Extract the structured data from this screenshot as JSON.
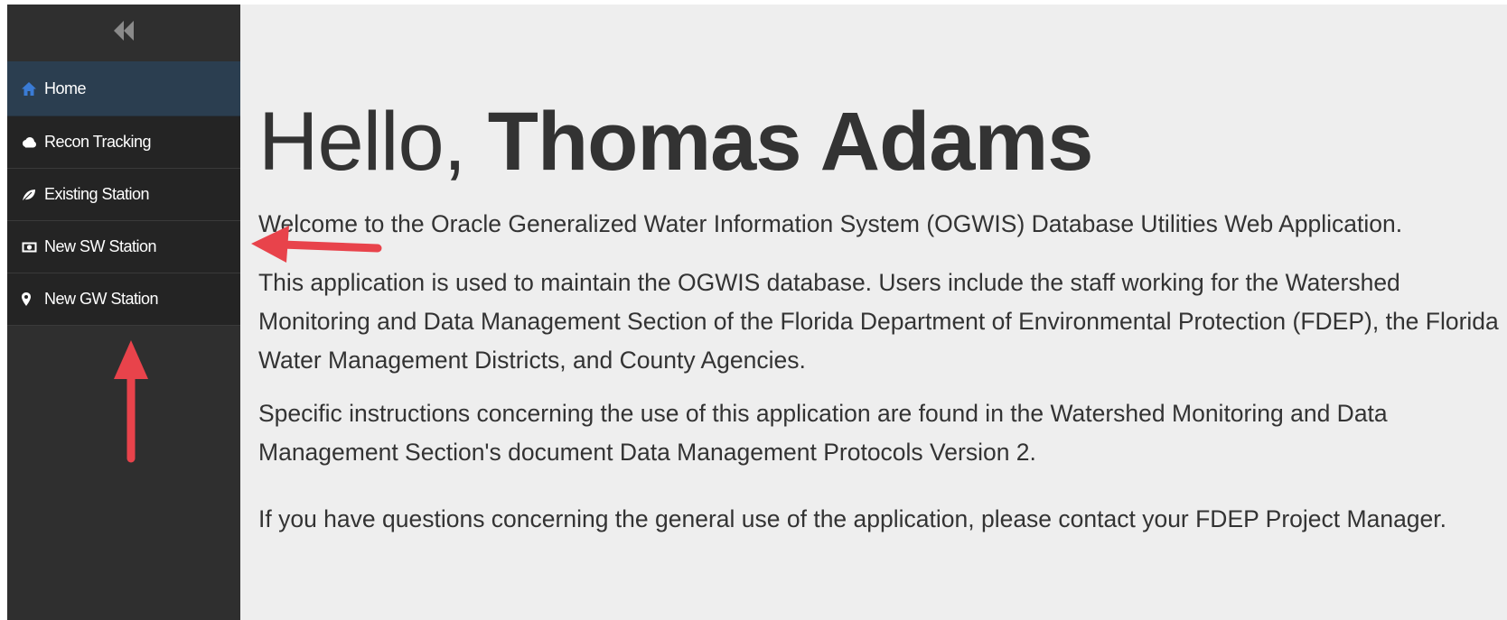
{
  "sidebar": {
    "collapse_icon": "double-chevron-left-icon",
    "items": [
      {
        "label": "Home",
        "icon": "home-icon",
        "active": true
      },
      {
        "label": "Recon Tracking",
        "icon": "cloud-icon"
      },
      {
        "label": "Existing Station",
        "icon": "leaf-icon"
      },
      {
        "label": "New SW Station",
        "icon": "money-icon"
      },
      {
        "label": "New GW Station",
        "icon": "map-marker-icon"
      }
    ]
  },
  "main": {
    "greeting_prefix": "Hello,",
    "user_name": "Thomas Adams",
    "paragraphs": [
      "Welcome to the Oracle Generalized Water Information System (OGWIS) Database Utilities Web Application.",
      "This application is used to maintain the OGWIS database. Users include the staff working for the Watershed Monitoring and Data Management Section of the Florida Department of Environmental Protection (FDEP), the Florida Water Management Districts, and County Agencies.",
      "Specific instructions concerning the use of this application are found in the Watershed Monitoring and Data Management Section's document Data Management Protocols Version 2.",
      "If you have questions concerning the general use of the application, please contact your FDEP Project Manager."
    ]
  },
  "colors": {
    "sidebar_bg": "#2f2f2f",
    "nav_item_bg": "#242424",
    "nav_active_bg": "#2b3e50",
    "home_icon": "#3a7bd5",
    "main_bg": "#eeeeee",
    "text": "#333333",
    "annotation_arrow": "#e8434b"
  }
}
